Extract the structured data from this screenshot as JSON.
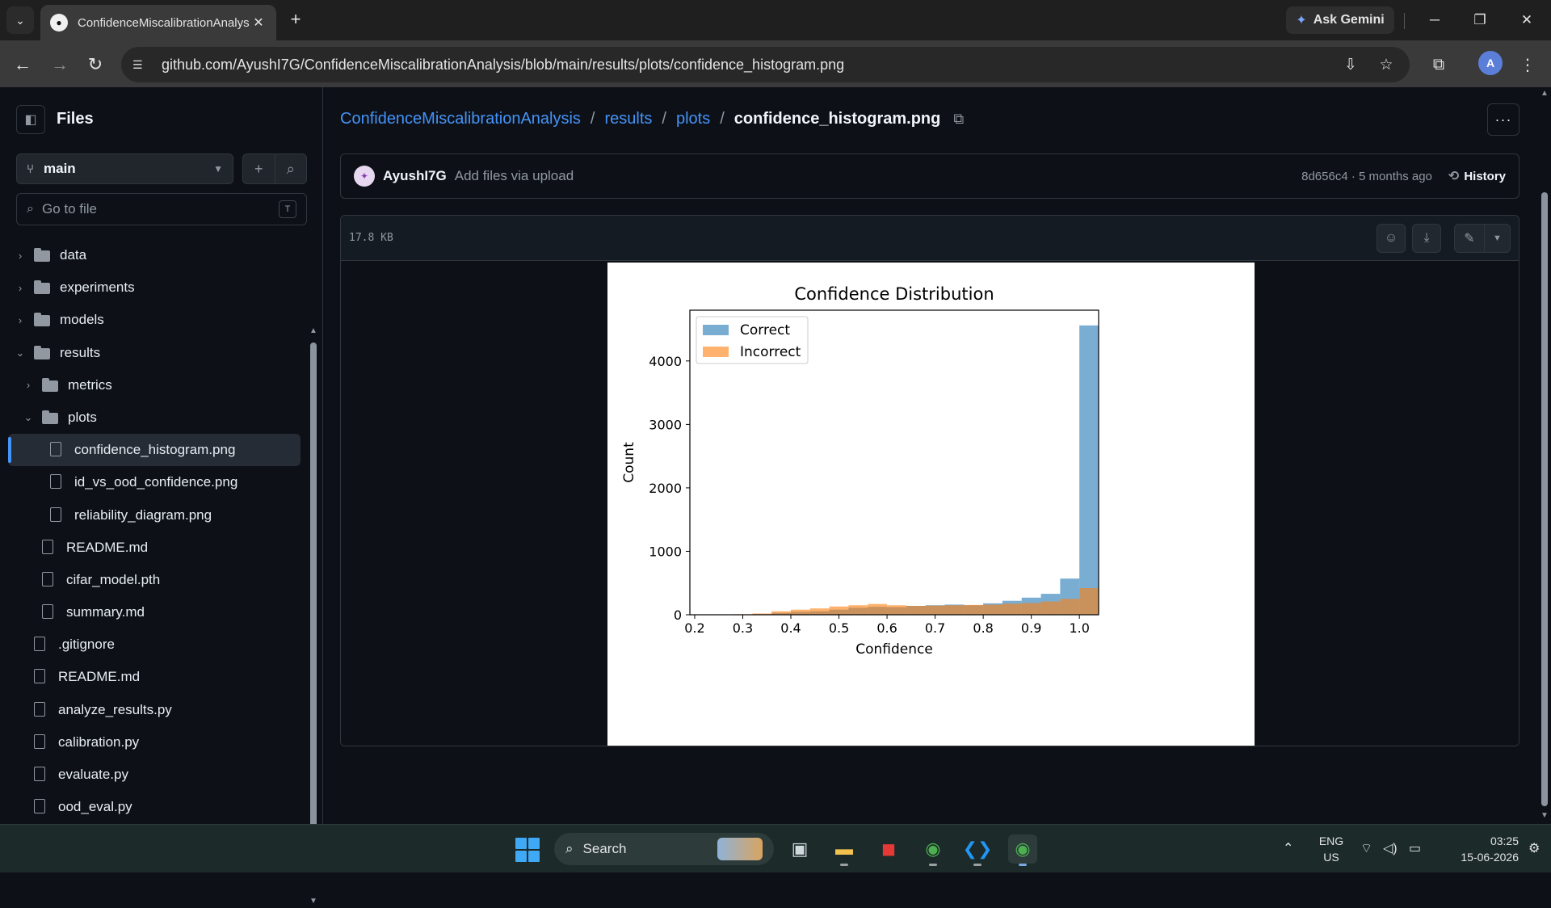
{
  "browser": {
    "tab_title": "ConfidenceMiscalibrationAnalys",
    "url": "github.com/AyushI7G/ConfidenceMiscalibrationAnalysis/blob/main/results/plots/confidence_histogram.png",
    "gemini_label": "Ask Gemini"
  },
  "sidebar": {
    "title": "Files",
    "branch": "main",
    "goto_placeholder": "Go to file",
    "goto_shortcut": "T",
    "tree": [
      {
        "label": "data",
        "type": "folder",
        "expanded": false,
        "depth": 0
      },
      {
        "label": "experiments",
        "type": "folder",
        "expanded": false,
        "depth": 0
      },
      {
        "label": "models",
        "type": "folder",
        "expanded": false,
        "depth": 0
      },
      {
        "label": "results",
        "type": "folder",
        "expanded": true,
        "depth": 0
      },
      {
        "label": "metrics",
        "type": "folder",
        "expanded": false,
        "depth": 1
      },
      {
        "label": "plots",
        "type": "folder",
        "expanded": true,
        "depth": 1
      },
      {
        "label": "confidence_histogram.png",
        "type": "file",
        "depth": 2,
        "active": true
      },
      {
        "label": "id_vs_ood_confidence.png",
        "type": "file",
        "depth": 2
      },
      {
        "label": "reliability_diagram.png",
        "type": "file",
        "depth": 2
      },
      {
        "label": "README.md",
        "type": "file",
        "depth": 1
      },
      {
        "label": "cifar_model.pth",
        "type": "file",
        "depth": 1
      },
      {
        "label": "summary.md",
        "type": "file",
        "depth": 1
      },
      {
        "label": ".gitignore",
        "type": "file",
        "depth": 0
      },
      {
        "label": "README.md",
        "type": "file",
        "depth": 0
      },
      {
        "label": "analyze_results.py",
        "type": "file",
        "depth": 0
      },
      {
        "label": "calibration.py",
        "type": "file",
        "depth": 0
      },
      {
        "label": "evaluate.py",
        "type": "file",
        "depth": 0
      },
      {
        "label": "ood_eval.py",
        "type": "file",
        "depth": 0
      }
    ]
  },
  "breadcrumb": {
    "repo": "ConfidenceMiscalibrationAnalysis",
    "sep": "/",
    "dir1": "results",
    "dir2": "plots",
    "file": "confidence_histogram.png"
  },
  "commit": {
    "author": "AyushI7G",
    "message": "Add files via upload",
    "meta": "8d656c4 · 5 months ago",
    "history_label": "History"
  },
  "file": {
    "size": "17.8 KB"
  },
  "chart_data": {
    "type": "bar",
    "title": "Confidence Distribution",
    "xlabel": "Confidence",
    "ylabel": "Count",
    "xlim": [
      0.19,
      1.04
    ],
    "ylim": [
      0,
      4800
    ],
    "xticks": [
      "0.2",
      "0.3",
      "0.4",
      "0.5",
      "0.6",
      "0.7",
      "0.8",
      "0.9",
      "1.0"
    ],
    "yticks": [
      "0",
      "1000",
      "2000",
      "3000",
      "4000"
    ],
    "legend_position": "top-left",
    "bin_edges": [
      0.24,
      0.28,
      0.32,
      0.36,
      0.4,
      0.44,
      0.48,
      0.52,
      0.56,
      0.6,
      0.64,
      0.68,
      0.72,
      0.76,
      0.8,
      0.84,
      0.88,
      0.92,
      0.96,
      1.0
    ],
    "series": [
      {
        "name": "Correct",
        "color": "#1f77b4",
        "values": [
          0,
          5,
          10,
          30,
          45,
          55,
          80,
          110,
          125,
          120,
          140,
          150,
          160,
          150,
          180,
          220,
          270,
          330,
          570,
          4560
        ]
      },
      {
        "name": "Incorrect",
        "color": "#ff7f0e",
        "values": [
          2,
          8,
          20,
          55,
          80,
          100,
          130,
          150,
          170,
          150,
          140,
          145,
          150,
          155,
          160,
          175,
          185,
          210,
          250,
          420
        ]
      }
    ]
  },
  "taskbar": {
    "search_label": "Search",
    "lang_line1": "ENG",
    "lang_line2": "US",
    "time": "03:25",
    "date": "15-06-2026"
  }
}
